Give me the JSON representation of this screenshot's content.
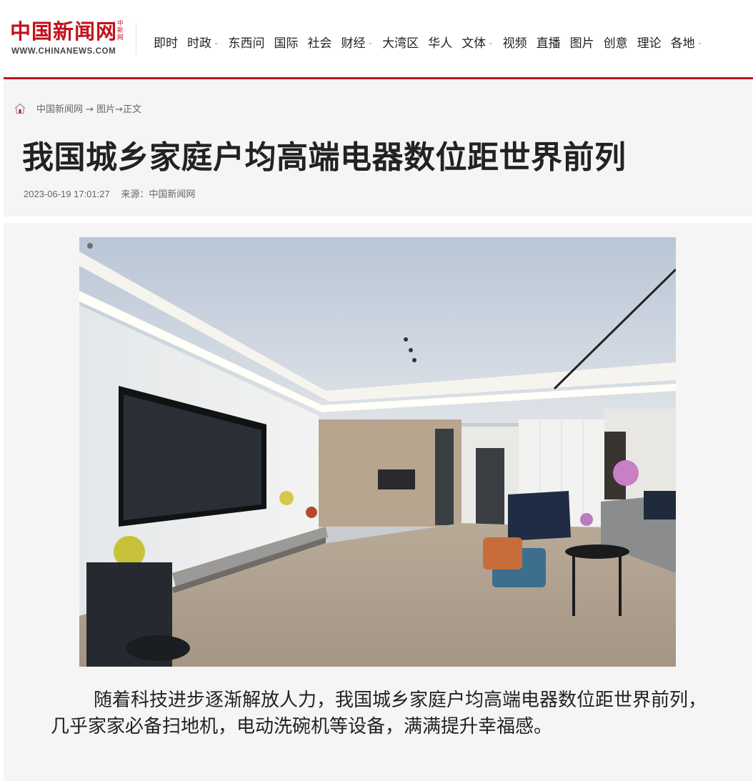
{
  "header": {
    "logo_cn": "中国新闻网",
    "logo_vertical": "中新网",
    "logo_en": "WWW.CHINANEWS.COM",
    "nav": [
      {
        "label": "即时",
        "has_dropdown": false
      },
      {
        "label": "时政",
        "has_dropdown": true
      },
      {
        "label": "东西问",
        "has_dropdown": false
      },
      {
        "label": "国际",
        "has_dropdown": false
      },
      {
        "label": "社会",
        "has_dropdown": false
      },
      {
        "label": "财经",
        "has_dropdown": true
      },
      {
        "label": "大湾区",
        "has_dropdown": false
      },
      {
        "label": "华人",
        "has_dropdown": false
      },
      {
        "label": "文体",
        "has_dropdown": true
      },
      {
        "label": "视频",
        "has_dropdown": false
      },
      {
        "label": "直播",
        "has_dropdown": false
      },
      {
        "label": "图片",
        "has_dropdown": false
      },
      {
        "label": "创意",
        "has_dropdown": false
      },
      {
        "label": "理论",
        "has_dropdown": false
      },
      {
        "label": "各地",
        "has_dropdown": true
      }
    ]
  },
  "breadcrumb": {
    "text": "中国新闻网 → 图片→正文"
  },
  "article": {
    "title": "我国城乡家庭户均高端电器数位距世界前列",
    "datetime": "2023-06-19 17:01:27",
    "source": "来源：中国新闻网",
    "paragraph": "随着科技进步逐渐解放人力，我国城乡家庭户均高端电器数位距世界前列，几乎家家必备扫地机，电动洗碗机等设备，满满提升幸福感。"
  },
  "colors": {
    "brand_red": "#c1121c",
    "panel_bg": "#f5f5f5",
    "title_text": "#222222"
  },
  "icons": {
    "home": "home-icon",
    "dropdown": "chevron-down-icon"
  }
}
